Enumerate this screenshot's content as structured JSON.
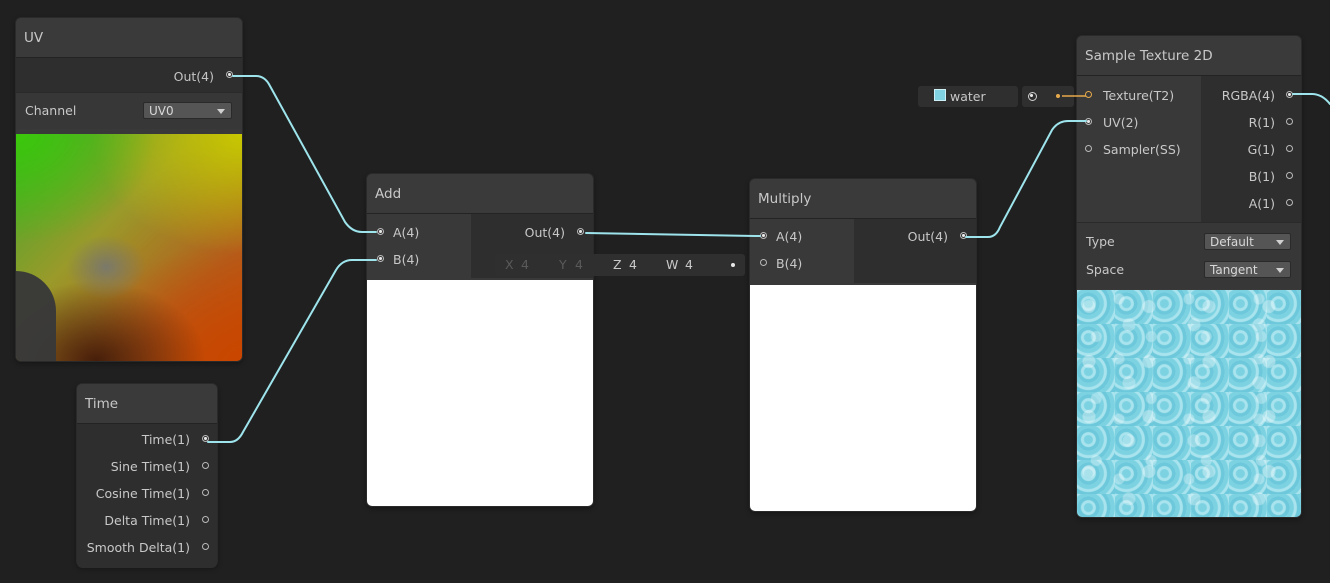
{
  "uv_node": {
    "title": "UV",
    "output_label": "Out(4)",
    "channel_label": "Channel",
    "channel_value": "UV0"
  },
  "time_node": {
    "title": "Time",
    "outputs": [
      "Time(1)",
      "Sine Time(1)",
      "Cosine Time(1)",
      "Delta Time(1)",
      "Smooth Delta(1)"
    ]
  },
  "add_node": {
    "title": "Add",
    "inputs": [
      "A(4)",
      "B(4)"
    ],
    "output_label": "Out(4)",
    "b_default": {
      "x_label": "X",
      "x_value": "4",
      "y_label": "Y",
      "y_value": "4",
      "z_label": "Z",
      "z_value": "4",
      "w_label": "W",
      "w_value": "4"
    }
  },
  "multiply_node": {
    "title": "Multiply",
    "inputs": [
      "A(4)",
      "B(4)"
    ],
    "output_label": "Out(4)"
  },
  "texture_property": {
    "name": "water"
  },
  "sample_texture_node": {
    "title": "Sample Texture 2D",
    "inputs": [
      "Texture(T2)",
      "UV(2)",
      "Sampler(SS)"
    ],
    "outputs": [
      "RGBA(4)",
      "R(1)",
      "G(1)",
      "B(1)",
      "A(1)"
    ],
    "type_label": "Type",
    "type_value": "Default",
    "space_label": "Space",
    "space_value": "Tangent"
  },
  "colors": {
    "background": "#202020",
    "node_body": "#393939",
    "wire_vector": "#9ee4ec",
    "wire_texture": "#e6a94a",
    "preview_white": "#ffffff",
    "water_tint": "#7fd3e3"
  }
}
